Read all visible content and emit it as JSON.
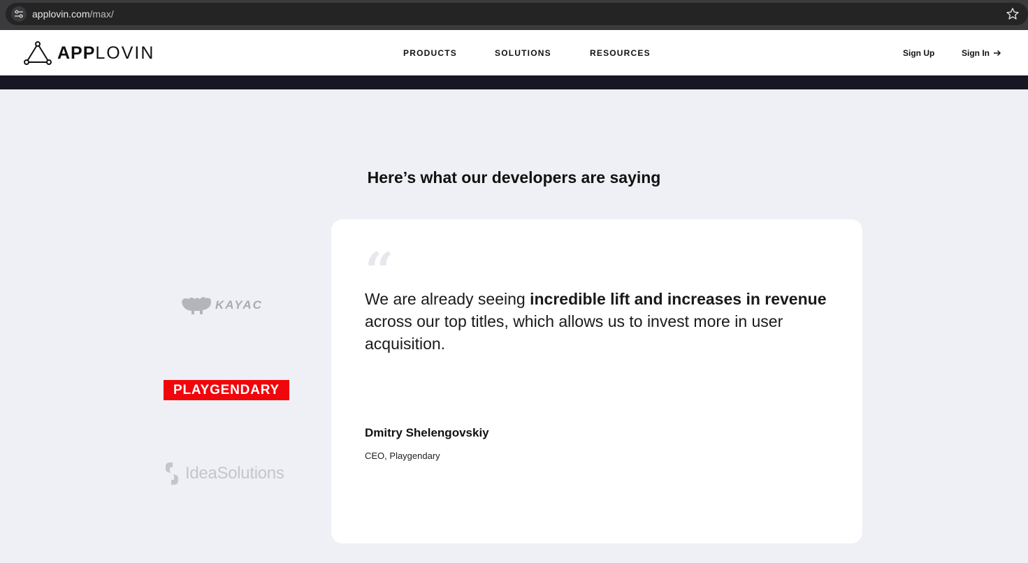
{
  "browser": {
    "url_domain": "applovin.com",
    "url_path": "/max/"
  },
  "header": {
    "logo_bold": "APP",
    "logo_light": "LOVIN",
    "nav": [
      "PRODUCTS",
      "SOLUTIONS",
      "RESOURCES"
    ],
    "sign_up": "Sign Up",
    "sign_in": "Sign In"
  },
  "section": {
    "title": "Here’s what our developers are saying"
  },
  "partners": {
    "kayac": "KAYAC",
    "playgendary": "PLAYGENDARY",
    "ideasolutions": "IdeaSolutions"
  },
  "testimonial": {
    "quote_open": "“",
    "text_before": "We are already seeing ",
    "text_bold": "incredible lift and increases in revenue",
    "text_after": " across our top titles, which allows us to invest more in user acquisition.",
    "author": "Dmitry Shelengovskiy",
    "role": "CEO, Playgendary"
  },
  "colors": {
    "accent_red": "#f0060b",
    "dark_strip": "#161624",
    "section_bg": "#eef0f5"
  }
}
